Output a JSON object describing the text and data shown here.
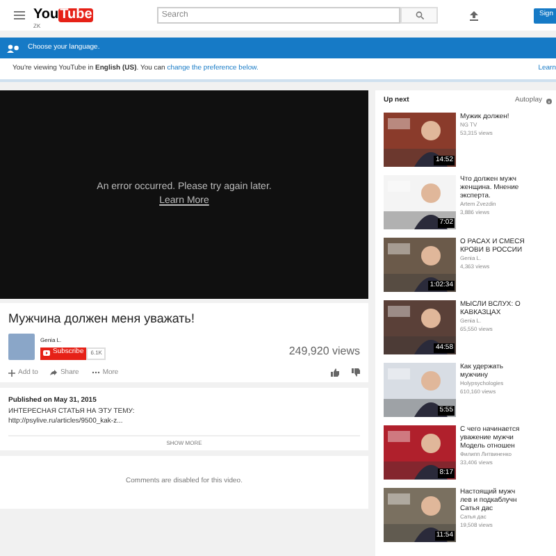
{
  "header": {
    "logo_left": "You",
    "logo_right": "Tube",
    "country": "ZK",
    "search": {
      "placeholder": "Search"
    },
    "sign_in": "Sign"
  },
  "language_banner": {
    "title": "Choose your language.",
    "message": "You're viewing YouTube in **English (US)**. You can",
    "link": "change the preference below.",
    "learn": "Learn"
  },
  "player": {
    "error": "An error occurred. Please try again later.",
    "link": "Learn More"
  },
  "video": {
    "title": "Мужчина должен меня уважать!",
    "channel": "Genia L.",
    "subscribe": "Subscribe",
    "subscribers": "6.1K",
    "views": "249,920 views",
    "actions": [
      {
        "kind": "add",
        "label": "Add to"
      },
      {
        "kind": "share",
        "label": "Share"
      },
      {
        "kind": "more",
        "label": "More"
      }
    ]
  },
  "description": {
    "published": "Published on May 31, 2015",
    "lines": [
      "ИНТЕРЕСНАЯ СТАТЬЯ НА ЭТУ ТЕМУ:",
      "http://psylive.ru/articles/9500_kak-z..."
    ],
    "show_more": "SHOW MORE"
  },
  "comments": {
    "message": "Comments are disabled for this video."
  },
  "sidebar": {
    "title": "Up next",
    "autoplay": "Autoplay",
    "items": [
      {
        "title": [
          "Мужик должен!"
        ],
        "channel": "NG TV",
        "views": "53,315 views",
        "duration": "14:52"
      },
      {
        "title": [
          "Что должен мужч",
          "женщина. Мнение",
          "эксперта."
        ],
        "channel": "Artem Zvezdin",
        "views": "3,886 views",
        "duration": "7:02"
      },
      {
        "title": [
          "О РАСАХ И СМЕСЯ",
          "КРОВИ В РОССИИ"
        ],
        "channel": "Genia L.",
        "views": "4,363 views",
        "duration": "1:02:34"
      },
      {
        "title": [
          "МЫСЛИ ВСЛУХ: О",
          "КАВКАЗЦАХ"
        ],
        "channel": "Genia L.",
        "views": "65,550 views",
        "duration": "44:58"
      },
      {
        "title": [
          "Как удержать",
          "мужчину"
        ],
        "channel": "Holypsychologies",
        "views": "610,160 views",
        "duration": "5:55"
      },
      {
        "title": [
          "С чего начинается",
          "уважение мужчи",
          "Модель отношен"
        ],
        "channel": "Филипп Литвиненко",
        "views": "33,406 views",
        "duration": "8:17"
      },
      {
        "title": [
          "Настоящий мужч",
          "лев и подкаблучн",
          "Сатья дас"
        ],
        "channel": "Сатья дас",
        "views": "19,508 views",
        "duration": "11:54"
      }
    ]
  }
}
